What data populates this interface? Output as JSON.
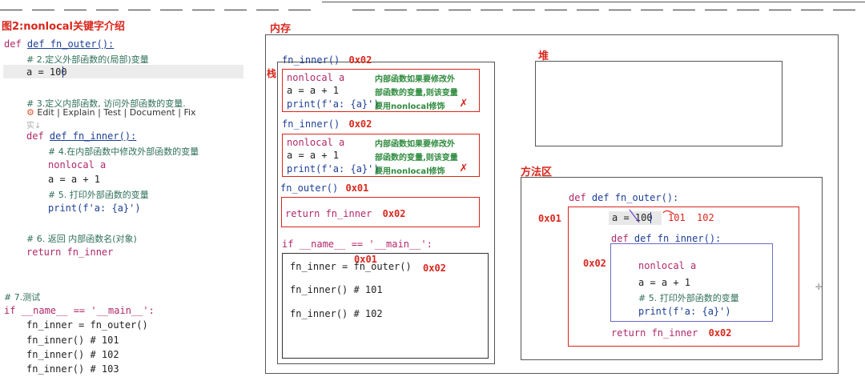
{
  "figure_title": "图2:nonlocal关键字介绍",
  "toolbar": {
    "edit": "Edit",
    "explain": "Explain",
    "test": "Test",
    "document": "Document",
    "fix": "Fix"
  },
  "left_code": {
    "line_def_outer": "def fn_outer():",
    "c2": "# 2.定义外部函数的(局部)变量",
    "a_assign": "a = 100",
    "c3": "# 3.定义内部函数, 访问外部函数的变量.",
    "truncated": "实↓",
    "def_inner": "def fn_inner():",
    "c4": "# 4.在内部函数中修改外部函数的变量",
    "nonlocal": "nonlocal a",
    "a_plus": "a = a + 1",
    "c5": "# 5. 打印外部函数的变量",
    "print": "print(f'a: {a}')",
    "c6": "# 6. 返回 内部函数名(对象)",
    "return": "return fn_inner",
    "c7": "# 7.测试",
    "if_main": "if __name__ == '__main__':",
    "t1": "fn_inner = fn_outer()",
    "t2": "fn_inner()  # 101",
    "t3": "fn_inner()  # 102",
    "t4": "fn_inner()  # 103"
  },
  "memory": {
    "title": "内存",
    "stack_label": "栈",
    "heap_label": "堆",
    "method_area_label": "方法区",
    "frame1": {
      "header": "fn_inner()",
      "addr": "0x02",
      "l1": "nonlocal a",
      "l2": "a = a + 1",
      "l3": "print(f'a: {a}')",
      "note1": "内部函数如果要修改外",
      "note2": "部函数的变量,则该变量",
      "note3": "要用nonlocal修饰"
    },
    "frame2": {
      "header": "fn_inner()",
      "addr": "0x02",
      "l1": "nonlocal a",
      "l2": "a = a + 1",
      "l3": "print(f'a: {a}')",
      "note1": "内部函数如果要修改外",
      "note2": "部函数的变量,则该变量",
      "note3": "要用nonlocal修饰"
    },
    "frame3": {
      "header": "fn_outer()",
      "addr": "0x01",
      "ret": "return fn_inner",
      "ret_addr": "0x02"
    },
    "main": {
      "header": "if __name__ == '__main__':",
      "l1": "fn_inner = fn_outer()",
      "addr_a": "0x01",
      "addr_b": "0x02",
      "l2": "fn_inner()  # 101",
      "l3": "fn_inner()  # 102"
    },
    "method": {
      "def_outer": "def fn_outer():",
      "addr_outer": "0x01",
      "a_assign": "a = 100",
      "v101": "101",
      "v102": "102",
      "def_inner": "def fn_inner():",
      "addr_inner": "0x02",
      "nonlocal": "nonlocal a",
      "a_plus": "a = a + 1",
      "comment": "# 5. 打印外部函数的变量",
      "print": "print(f'a: {a}')",
      "ret": "return fn_inner",
      "ret_addr": "0x02"
    }
  },
  "colors": {
    "red": "#d9261c",
    "keyword": "#b0286a",
    "func": "#1c3f96",
    "comment": "#2e6f57",
    "green": "#2e8b3e"
  }
}
